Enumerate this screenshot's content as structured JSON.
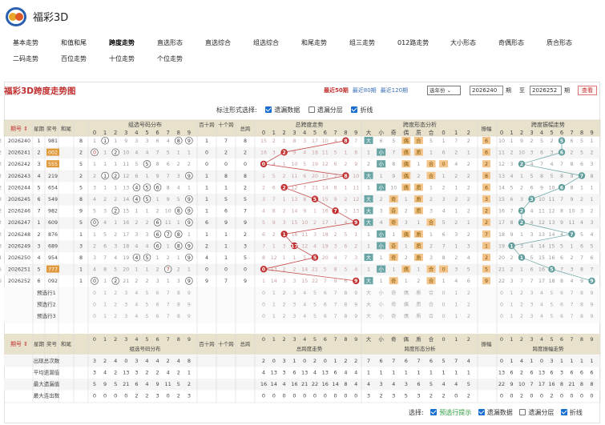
{
  "app": {
    "title": "福彩3D"
  },
  "nav": [
    "基本走势",
    "和值和尾",
    "跨度走势",
    "直选形态",
    "直选综合",
    "组选综合",
    "和尾走势",
    "组三走势",
    "012路走势",
    "大小形态",
    "奇偶形态",
    "质合形态",
    "二码走势",
    "百位走势",
    "十位走势",
    "个位走势"
  ],
  "nav_active": 2,
  "panel": {
    "title": "福彩3D跨度走势图",
    "period_links": [
      "最近50期",
      "最近80期",
      "最近120期"
    ],
    "year_select": "选年份",
    "range_from": "2026240",
    "range_label_qi": "期",
    "range_to_label": "至",
    "range_to": "2026252",
    "query_button": "查看"
  },
  "options": {
    "label": "标注形式选择:",
    "items": [
      {
        "label": "遗漏数据",
        "checked": true
      },
      {
        "label": "遗漏分层",
        "checked": false
      },
      {
        "label": "折线",
        "checked": true
      }
    ]
  },
  "table": {
    "group_headers": [
      "组选号码分布",
      "百十跨",
      "十个跨",
      "总跨",
      "总跨度走势",
      "跨度形态分析",
      "振幅",
      "跨度振幅走势"
    ],
    "col_headers": [
      "期号",
      "星期",
      "奖号",
      "和尾"
    ],
    "digits": [
      "0",
      "1",
      "2",
      "3",
      "4",
      "5",
      "6",
      "7",
      "8",
      "9"
    ],
    "shape_headers": [
      "大",
      "小",
      "奇",
      "偶",
      "质",
      "合",
      "0",
      "1",
      "2"
    ],
    "rows": [
      {
        "issue": "2026240",
        "week": "1",
        "num": "981",
        "tail": "8",
        "zu": [
          "1",
          "①",
          "1",
          "9",
          "3",
          "3",
          "6",
          "4",
          "⑧",
          "⑨"
        ],
        "bs": "1",
        "sg": "7",
        "span": "8",
        "sp": [
          "15",
          "2",
          "1",
          "8",
          "3",
          "17",
          "10",
          "4",
          "8",
          "7"
        ],
        "shape": [
          "大",
          "6",
          "5",
          "偶",
          "合",
          "5",
          "1",
          "7",
          "2",
          "2"
        ],
        "amp": "6",
        "ampw": [
          "10",
          "1",
          "9",
          "2",
          "5",
          "2",
          "5",
          "6",
          "5",
          "1"
        ]
      },
      {
        "issue": "2026241",
        "week": "2",
        "num": "002",
        "tail": "2",
        "zu": [
          "⓪",
          "1",
          "②",
          "10",
          "4",
          "4",
          "7",
          "5",
          "1",
          "1"
        ],
        "bs": "0",
        "sg": "2",
        "span": "2",
        "sp": [
          "16",
          "3",
          "2",
          "9",
          "4",
          "18",
          "11",
          "5",
          "1",
          "8"
        ],
        "shape": [
          "1",
          "小",
          "7",
          "偶",
          "质",
          "1",
          "6",
          "2",
          "1",
          "2"
        ],
        "amp": "6",
        "ampw": [
          "11",
          "2",
          "10",
          "3",
          "6",
          "3",
          "6",
          "2",
          "5",
          "2"
        ]
      },
      {
        "issue": "2026242",
        "week": "3",
        "num": "555",
        "tail": "5",
        "zu": [
          "1",
          "1",
          "1",
          "11",
          "5",
          "⑤",
          "8",
          "6",
          "2",
          "2"
        ],
        "bs": "0",
        "sg": "0",
        "span": "0",
        "sp": [
          "0",
          "4",
          "1",
          "10",
          "5",
          "19",
          "12",
          "6",
          "2",
          "9"
        ],
        "shape": [
          "2",
          "小",
          "8",
          "偶",
          "1",
          "合",
          "0",
          "4",
          "2",
          "2"
        ],
        "amp": "2",
        "ampw": [
          "12",
          "3",
          "2",
          "4",
          "7",
          "4",
          "7",
          "8",
          "6",
          "3"
        ]
      },
      {
        "issue": "2026243",
        "week": "4",
        "num": "219",
        "tail": "2",
        "zu": [
          "2",
          "①",
          "②",
          "12",
          "6",
          "1",
          "9",
          "7",
          "3",
          "⑨"
        ],
        "bs": "1",
        "sg": "8",
        "span": "8",
        "sp": [
          "1",
          "5",
          "2",
          "11",
          "6",
          "20",
          "13",
          "7",
          "8",
          "10"
        ],
        "shape": [
          "大",
          "1",
          "9",
          "偶",
          "2",
          "合",
          "1",
          "2",
          "2",
          "2"
        ],
        "amp": "8",
        "ampw": [
          "13",
          "4",
          "1",
          "5",
          "8",
          "5",
          "8",
          "9",
          "7",
          "8"
        ]
      },
      {
        "issue": "2026244",
        "week": "5",
        "num": "654",
        "tail": "5",
        "zu": [
          "3",
          "1",
          "1",
          "13",
          "④",
          "⑤",
          "⑥",
          "8",
          "4",
          "1"
        ],
        "bs": "1",
        "sg": "1",
        "span": "2",
        "sp": [
          "2",
          "6",
          "2",
          "12",
          "7",
          "21",
          "14",
          "8",
          "1",
          "11"
        ],
        "shape": [
          "1",
          "小",
          "10",
          "偶",
          "质",
          "1",
          "2",
          "1",
          "2",
          "2"
        ],
        "amp": "6",
        "ampw": [
          "14",
          "5",
          "2",
          "6",
          "9",
          "10",
          "6",
          "8",
          "1",
          "1"
        ]
      },
      {
        "issue": "2026245",
        "week": "6",
        "num": "549",
        "tail": "8",
        "zu": [
          "4",
          "2",
          "2",
          "14",
          "④",
          "⑤",
          "1",
          "9",
          "5",
          "⑨"
        ],
        "bs": "1",
        "sg": "5",
        "span": "5",
        "sp": [
          "3",
          "7",
          "1",
          "13",
          "8",
          "5",
          "15",
          "9",
          "2",
          "12"
        ],
        "shape": [
          "大",
          "2",
          "奇",
          "1",
          "质",
          "2",
          "3",
          "2",
          "2",
          "3"
        ],
        "amp": "3",
        "ampw": [
          "15",
          "6",
          "3",
          "3",
          "10",
          "11",
          "7",
          "9",
          "2",
          "1"
        ]
      },
      {
        "issue": "2026246",
        "week": "7",
        "num": "982",
        "tail": "9",
        "zu": [
          "5",
          "3",
          "②",
          "15",
          "1",
          "1",
          "2",
          "10",
          "⑧",
          "⑨"
        ],
        "bs": "1",
        "sg": "6",
        "span": "7",
        "sp": [
          "4",
          "8",
          "2",
          "14",
          "9",
          "1",
          "16",
          "7",
          "3",
          "13"
        ],
        "shape": [
          "大",
          "3",
          "奇",
          "2",
          "质",
          "3",
          "4",
          "1",
          "2",
          "2"
        ],
        "amp": "2",
        "ampw": [
          "16",
          "7",
          "2",
          "4",
          "11",
          "12",
          "8",
          "10",
          "3",
          "2"
        ]
      },
      {
        "issue": "2026247",
        "week": "1",
        "num": "609",
        "tail": "5",
        "zu": [
          "⓪",
          "4",
          "1",
          "16",
          "2",
          "2",
          "⑥",
          "11",
          "1",
          "⑨"
        ],
        "bs": "6",
        "sg": "9",
        "span": "9",
        "sp": [
          "5",
          "9",
          "3",
          "15",
          "10",
          "2",
          "17",
          "1",
          "4",
          "9"
        ],
        "shape": [
          "大",
          "4",
          "奇",
          "3",
          "1",
          "合",
          "5",
          "2",
          "1",
          "2"
        ],
        "amp": "2",
        "ampw": [
          "17",
          "8",
          "2",
          "4",
          "12",
          "13",
          "9",
          "11",
          "4",
          "3"
        ]
      },
      {
        "issue": "2026248",
        "week": "2",
        "num": "876",
        "tail": "1",
        "zu": [
          "1",
          "5",
          "2",
          "17",
          "3",
          "3",
          "⑥",
          "⑦",
          "⑧",
          "1"
        ],
        "bs": "1",
        "sg": "1",
        "span": "2",
        "sp": [
          "6",
          "2",
          "1",
          "16",
          "11",
          "3",
          "18",
          "2",
          "5",
          "1"
        ],
        "shape": [
          "1",
          "小",
          "1",
          "偶",
          "质",
          "1",
          "6",
          "3",
          "2",
          "2"
        ],
        "amp": "7",
        "ampw": [
          "18",
          "9",
          "1",
          "3",
          "13",
          "14",
          "4",
          "7",
          "5",
          "4"
        ]
      },
      {
        "issue": "2026249",
        "week": "3",
        "num": "689",
        "tail": "3",
        "zu": [
          "2",
          "6",
          "3",
          "18",
          "4",
          "4",
          "⑥",
          "1",
          "⑧",
          "⑨"
        ],
        "bs": "2",
        "sg": "1",
        "span": "3",
        "sp": [
          "7",
          "1",
          "3",
          "17",
          "12",
          "4",
          "19",
          "3",
          "6",
          "2"
        ],
        "shape": [
          "1",
          "小",
          "奇",
          "1",
          "质",
          "2",
          "7",
          "1",
          "3",
          "3"
        ],
        "amp": "1",
        "ampw": [
          "19",
          "1",
          "3",
          "4",
          "14",
          "15",
          "5",
          "1",
          "6",
          "5"
        ]
      },
      {
        "issue": "2026250",
        "week": "4",
        "num": "954",
        "tail": "8",
        "zu": [
          "3",
          "7",
          "4",
          "19",
          "④",
          "⑤",
          "1",
          "2",
          "1",
          "⑨"
        ],
        "bs": "4",
        "sg": "1",
        "span": "5",
        "sp": [
          "8",
          "12",
          "1",
          "1",
          "5",
          "5",
          "20",
          "4",
          "7",
          "3"
        ],
        "shape": [
          "大",
          "1",
          "奇",
          "2",
          "质",
          "3",
          "8",
          "2",
          "4",
          "4"
        ],
        "amp": "2",
        "ampw": [
          "20",
          "2",
          "1",
          "5",
          "15",
          "16",
          "6",
          "2",
          "7",
          "6"
        ]
      },
      {
        "issue": "2026251",
        "week": "5",
        "num": "777",
        "tail": "1",
        "zu": [
          "4",
          "8",
          "5",
          "20",
          "1",
          "1",
          "2",
          "⑦",
          "2",
          "1"
        ],
        "bs": "0",
        "sg": "0",
        "span": "0",
        "sp": [
          "0",
          "13",
          "2",
          "2",
          "14",
          "21",
          "5",
          "8",
          "5",
          "4"
        ],
        "shape": [
          "1",
          "小",
          "1",
          "偶",
          "1",
          "合",
          "0",
          "3",
          "5",
          "5"
        ],
        "amp": "5",
        "ampw": [
          "21",
          "2",
          "1",
          "6",
          "16",
          "5",
          "7",
          "3",
          "8",
          "7"
        ]
      },
      {
        "issue": "2026252",
        "week": "6",
        "num": "092",
        "tail": "1",
        "zu": [
          "⓪",
          "1",
          "②",
          "21",
          "2",
          "2",
          "3",
          "1",
          "3",
          "⑨"
        ],
        "bs": "9",
        "sg": "7",
        "span": "9",
        "sp": [
          "1",
          "14",
          "3",
          "3",
          "15",
          "22",
          "7",
          "9",
          "6",
          "9"
        ],
        "shape": [
          "大",
          "1",
          "奇",
          "1",
          "2",
          "合",
          "1",
          "4",
          "6",
          "6"
        ],
        "amp": "9",
        "ampw": [
          "22",
          "3",
          "7",
          "7",
          "17",
          "18",
          "8",
          "4",
          "9",
          "9"
        ]
      }
    ],
    "pre_rows": [
      "预选行1",
      "预选行2",
      "预选行3"
    ],
    "stat_labels": [
      "出现总次数",
      "平均遗漏值",
      "最大遗漏值",
      "最大连出数"
    ],
    "bottom_col_headers": [
      "期号",
      "星期",
      "奖号",
      "和尾"
    ],
    "stats": {
      "zu": [
        [
          "3",
          "2",
          "4",
          "0",
          "3",
          "4",
          "4",
          "2",
          "4",
          "8"
        ],
        [
          "3",
          "4",
          "2",
          "13",
          "3",
          "2",
          "2",
          "4",
          "2",
          "1"
        ],
        [
          "5",
          "9",
          "5",
          "21",
          "6",
          "4",
          "9",
          "11",
          "5",
          "2"
        ],
        [
          "0",
          "0",
          "0",
          "0",
          "2",
          "2",
          "3",
          "0",
          "2",
          "3"
        ]
      ],
      "sp": [
        [
          "2",
          "0",
          "3",
          "1",
          "0",
          "2",
          "0",
          "1",
          "2",
          "2"
        ],
        [
          "4",
          "13",
          "3",
          "6",
          "13",
          "4",
          "13",
          "6",
          "4",
          "4"
        ],
        [
          "16",
          "14",
          "4",
          "16",
          "21",
          "22",
          "16",
          "14",
          "8",
          "4"
        ],
        [
          "0",
          "0",
          "0",
          "0",
          "0",
          "0",
          "0",
          "0",
          "0",
          "0"
        ]
      ],
      "shape": [
        [
          "7",
          "6",
          "7",
          "6",
          "7",
          "6",
          "5",
          "7",
          "4",
          "4"
        ],
        [
          "1",
          "1",
          "1",
          "1",
          "1",
          "1",
          "1",
          "1",
          "1",
          "1"
        ],
        [
          "4",
          "3",
          "4",
          "3",
          "6",
          "5",
          "4",
          "4",
          "5",
          "5"
        ],
        [
          "3",
          "2",
          "3",
          "5",
          "3",
          "2",
          "2",
          "0",
          "2",
          "0"
        ]
      ],
      "amp": [
        [
          "0",
          "1",
          "4",
          "1",
          "0",
          "3",
          "1",
          "1",
          "1",
          "1"
        ],
        [
          "13",
          "6",
          "2",
          "6",
          "13",
          "6",
          "3",
          "6",
          "6",
          "6"
        ],
        [
          "22",
          "9",
          "10",
          "7",
          "17",
          "16",
          "8",
          "21",
          "8",
          "8"
        ],
        [
          "0",
          "0",
          "2",
          "0",
          "0",
          "2",
          "0",
          "0",
          "0",
          "0"
        ]
      ]
    }
  },
  "bottom_bar": {
    "label": "选择:",
    "items": [
      {
        "label": "预选行提示",
        "checked": true,
        "highlight": true
      },
      {
        "label": "遗漏数据",
        "checked": true
      },
      {
        "label": "遗漏分层",
        "checked": false
      },
      {
        "label": "折线",
        "checked": true
      }
    ]
  },
  "colors": {
    "red": "#c03030",
    "teal": "#5f9c9c",
    "orange": "#e09a3c",
    "header": "#e8e2cc",
    "stripe": "#f5f5f5"
  }
}
